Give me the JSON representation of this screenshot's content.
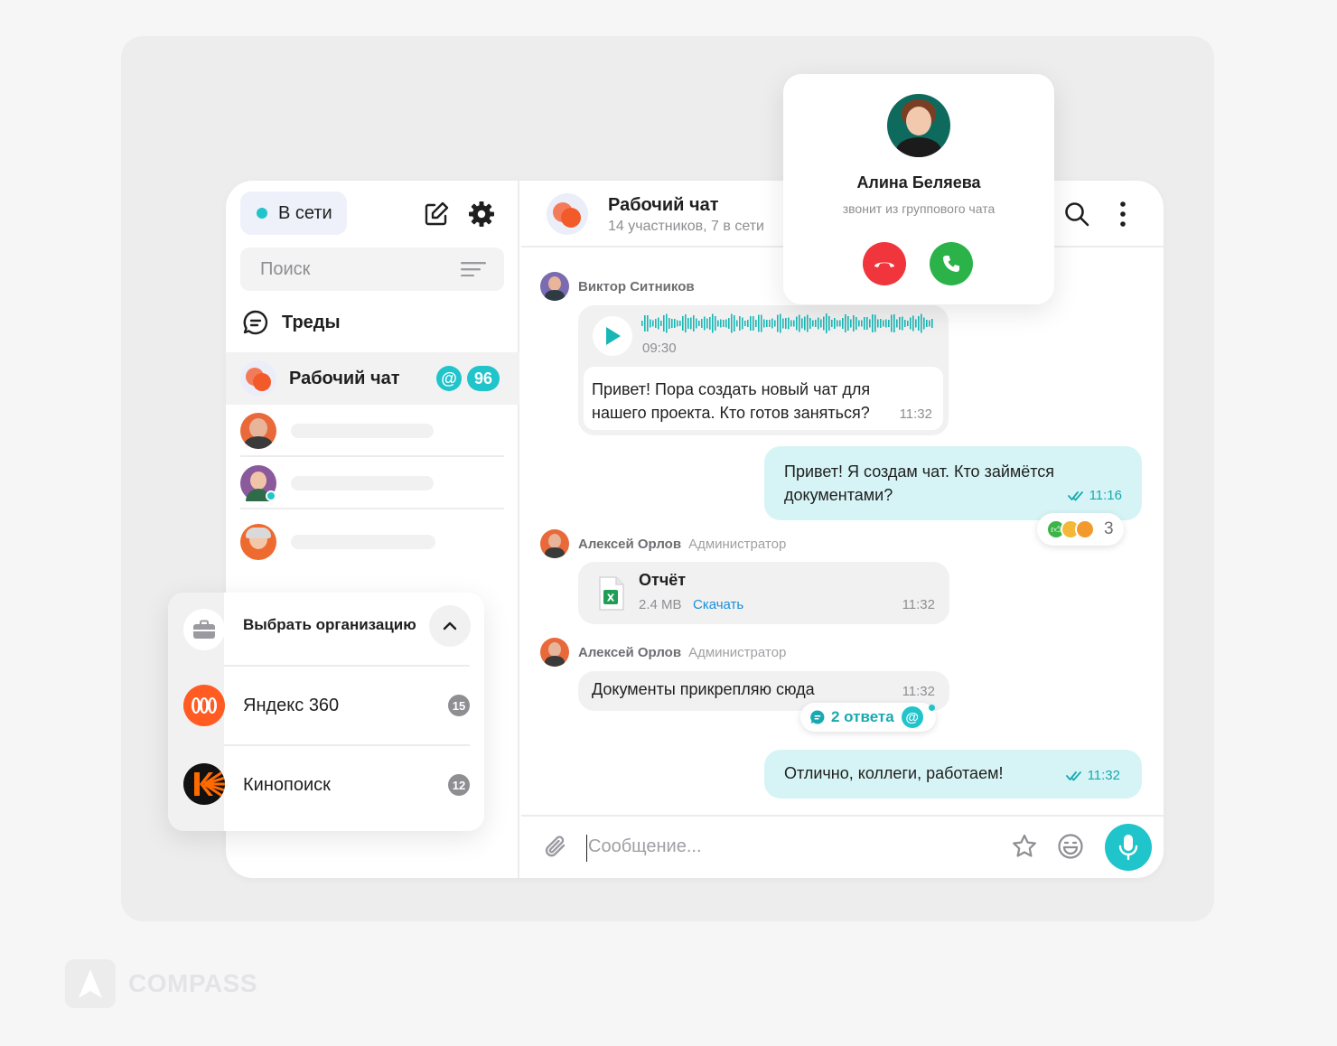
{
  "sidebar": {
    "status_label": "В сети",
    "search_placeholder": "Поиск",
    "threads_label": "Треды",
    "active_chat": {
      "title": "Рабочий чат",
      "mention": "@",
      "unread": "96"
    }
  },
  "header": {
    "title": "Рабочий чат",
    "subtitle": "14 участников, 7 в сети"
  },
  "messages": {
    "m1": {
      "sender": "Виктор Ситников",
      "voice_duration": "09:30",
      "text_line1": "Привет! Пора создать новый чат для",
      "text_line2": "нашего проекта. Кто готов заняться?",
      "time": "11:32"
    },
    "m2": {
      "text_line1": "Привет! Я создам чат. Кто займётся",
      "text_line2": "документами?",
      "time": "11:16",
      "reactions_count": "3"
    },
    "m3": {
      "sender": "Алексей Орлов",
      "role": "Администратор",
      "file_name": "Отчёт",
      "file_size": "2.4 MB",
      "download": "Скачать",
      "time": "11:32"
    },
    "m4": {
      "sender": "Алексей Орлов",
      "role": "Администратор",
      "text": "Документы прикрепляю сюда",
      "time": "11:32",
      "replies": "2 ответа",
      "mention": "@"
    },
    "m5": {
      "text": "Отлично, коллеги, работаем!",
      "time": "11:32"
    }
  },
  "composer": {
    "placeholder": "Сообщение..."
  },
  "org_menu": {
    "title": "Выбрать организацию",
    "items": [
      {
        "name": "Яндекс 360",
        "count": "15"
      },
      {
        "name": "Кинопоиск",
        "count": "12"
      }
    ]
  },
  "call": {
    "caller": "Алина Беляева",
    "note": "звонит из группового чата"
  },
  "brand": {
    "name": "COMPASS"
  },
  "colors": {
    "accent": "#20c4cb",
    "outgoing": "#d6f4f5",
    "decline": "#f0353c",
    "accept": "#2bb34a",
    "link": "#1a8fd8"
  }
}
